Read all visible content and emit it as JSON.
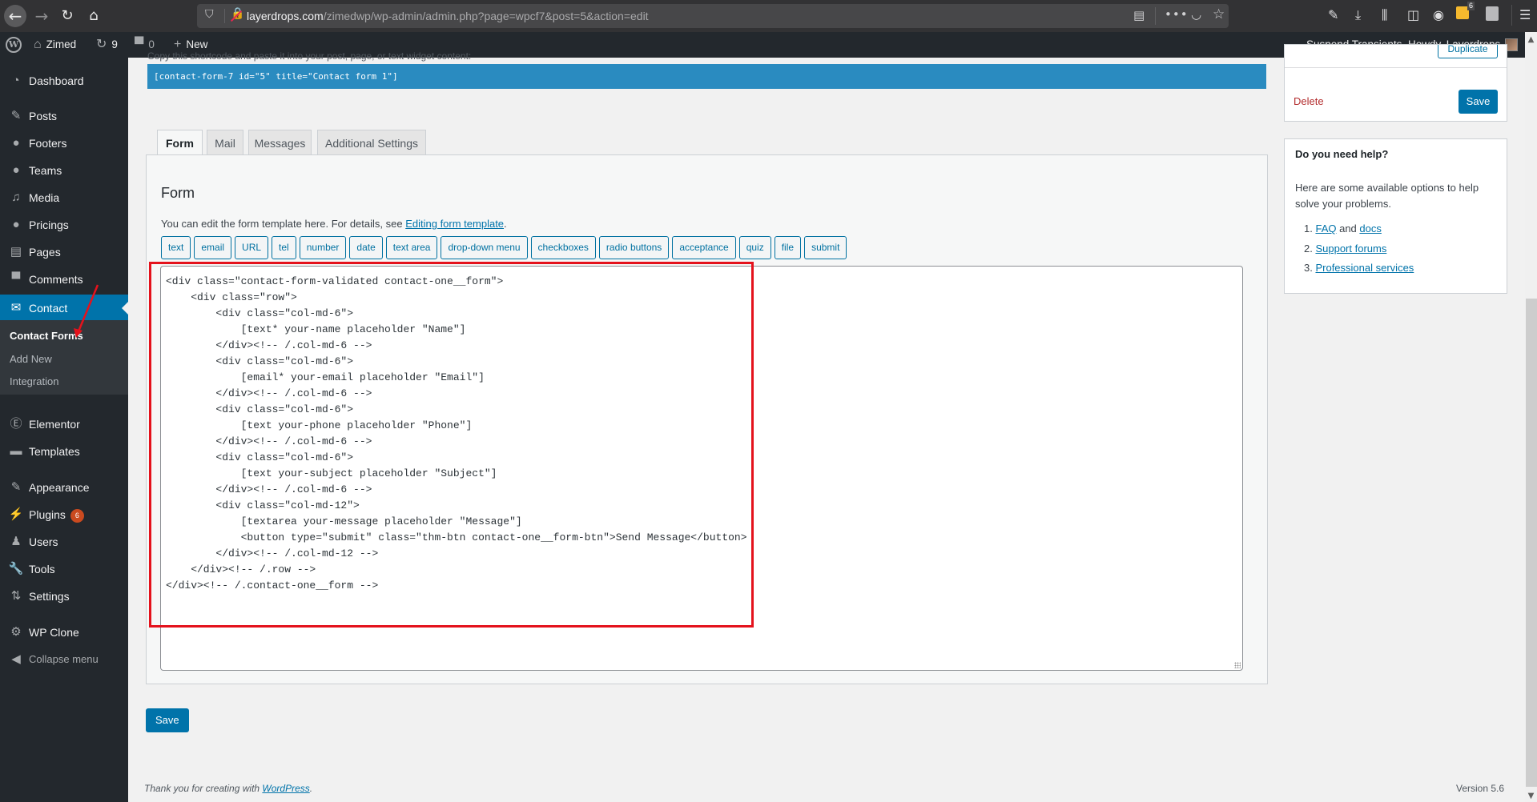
{
  "browser": {
    "url_host": "layerdrops.com",
    "url_path": "/zimedwp/wp-admin/admin.php?page=wpcf7&post=5&action=edit",
    "extension_badge": "6",
    "icons": {
      "back": "←",
      "forward": "→",
      "reload": "↻",
      "home": "⌂",
      "shield": "⛉",
      "reader": "▤",
      "more": "•••",
      "pocket": "◡",
      "star": "☆",
      "tools": "🔧",
      "download": "⤓",
      "library": "⫼",
      "sidebar": "◫",
      "account": "◉",
      "menu": "☰"
    }
  },
  "admin_bar": {
    "site_name": "Zimed",
    "updates_count": "9",
    "comments_count": "0",
    "new_label": "New",
    "suspend_transients": "Suspend Transients",
    "howdy": "Howdy, Layerdrops"
  },
  "sidebar": {
    "items": [
      {
        "label": "Dashboard",
        "icon": "◔"
      },
      {
        "label": "Posts",
        "icon": "✎"
      },
      {
        "label": "Footers",
        "icon": "●"
      },
      {
        "label": "Teams",
        "icon": "●"
      },
      {
        "label": "Media",
        "icon": "♫"
      },
      {
        "label": "Pricings",
        "icon": "●"
      },
      {
        "label": "Pages",
        "icon": "▤"
      },
      {
        "label": "Comments",
        "icon": "▀"
      },
      {
        "label": "Contact",
        "icon": "✉"
      },
      {
        "label": "Elementor",
        "icon": "Ⓔ"
      },
      {
        "label": "Templates",
        "icon": "▬"
      },
      {
        "label": "Appearance",
        "icon": "✎"
      },
      {
        "label": "Plugins",
        "icon": "⚡",
        "badge": "6"
      },
      {
        "label": "Users",
        "icon": "♟"
      },
      {
        "label": "Tools",
        "icon": "🔧"
      },
      {
        "label": "Settings",
        "icon": "⇅"
      },
      {
        "label": "WP Clone",
        "icon": "⚙"
      },
      {
        "label": "Collapse menu",
        "icon": "◀"
      }
    ],
    "submenu": [
      "Contact Forms",
      "Add New",
      "Integration"
    ]
  },
  "main": {
    "shortcode_note": "Copy this shortcode and paste it into your post, page, or text widget content:",
    "shortcode": "[contact-form-7 id=\"5\" title=\"Contact form 1\"]",
    "tabs": [
      "Form",
      "Mail",
      "Messages",
      "Additional Settings"
    ],
    "panel_title": "Form",
    "panel_desc_prefix": "You can edit the form template here. For details, see ",
    "panel_desc_link": "Editing form template",
    "panel_desc_suffix": ".",
    "tag_buttons": [
      "text",
      "email",
      "URL",
      "tel",
      "number",
      "date",
      "text area",
      "drop-down menu",
      "checkboxes",
      "radio buttons",
      "acceptance",
      "quiz",
      "file",
      "submit"
    ],
    "form_template": "<div class=\"contact-form-validated contact-one__form\">\n    <div class=\"row\">\n        <div class=\"col-md-6\">\n            [text* your-name placeholder \"Name\"]\n        </div><!-- /.col-md-6 -->\n        <div class=\"col-md-6\">\n            [email* your-email placeholder \"Email\"]\n        </div><!-- /.col-md-6 -->\n        <div class=\"col-md-6\">\n            [text your-phone placeholder \"Phone\"]\n        </div><!-- /.col-md-6 -->\n        <div class=\"col-md-6\">\n            [text your-subject placeholder \"Subject\"]\n        </div><!-- /.col-md-6 -->\n        <div class=\"col-md-12\">\n            [textarea your-message placeholder \"Message\"]\n            <button type=\"submit\" class=\"thm-btn contact-one__form-btn\">Send Message</button>\n        </div><!-- /.col-md-12 -->\n    </div><!-- /.row -->\n</div><!-- /.contact-one__form -->",
    "save_label": "Save"
  },
  "right_sidebar": {
    "duplicate_label": "Duplicate",
    "delete_label": "Delete",
    "save_label": "Save",
    "help_title": "Do you need help?",
    "help_text": "Here are some available options to help solve your problems.",
    "help_items": [
      {
        "num": "1. ",
        "link1": "FAQ",
        "mid": " and ",
        "link2": "docs"
      },
      {
        "num": "2. ",
        "link1": "Support forums"
      },
      {
        "num": "3. ",
        "link1": "Professional services"
      }
    ]
  },
  "footer": {
    "thanks_prefix": "Thank you for creating with ",
    "thanks_link": "WordPress",
    "thanks_suffix": ".",
    "version": "Version 5.6"
  },
  "colors": {
    "accent": "#0073aa",
    "shortcode_bg": "#2a8bc0",
    "admin_dark": "#23282d",
    "highlight_red": "#e4121c",
    "delete_red": "#b32d2e"
  }
}
